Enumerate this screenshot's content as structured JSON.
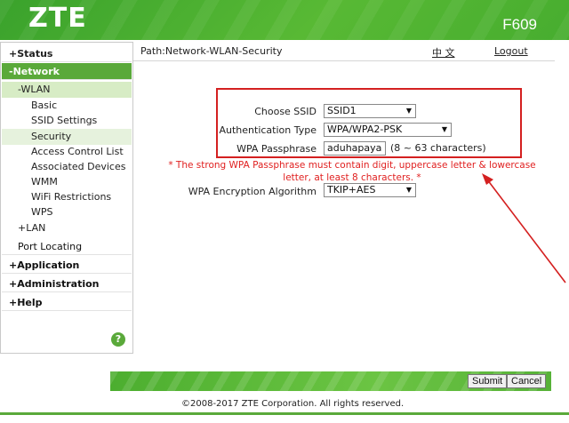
{
  "header": {
    "logo": "ZTE",
    "model": "F609"
  },
  "sidebar": {
    "status": "+Status",
    "network": "-Network",
    "wlan": "-WLAN",
    "wlan_items": [
      "Basic",
      "SSID Settings",
      "Security",
      "Access Control List",
      "Associated Devices",
      "WMM",
      "WiFi Restrictions",
      "WPS"
    ],
    "lan": "+LAN",
    "port_locating": "Port Locating",
    "application": "+Application",
    "administration": "+Administration",
    "help": "+Help",
    "help_icon": "?"
  },
  "pathbar": {
    "path": "Path:Network-WLAN-Security",
    "lang": "中 文",
    "logout": "Logout"
  },
  "form": {
    "ssid_label": "Choose SSID",
    "ssid_value": "SSID1",
    "auth_label": "Authentication Type",
    "auth_value": "WPA/WPA2-PSK",
    "pass_label": "WPA Passphrase",
    "pass_value": "aduhapaya",
    "pass_hint": "(8 ~ 63 characters)",
    "warning": "* The strong WPA Passphrase must contain digit, uppercase letter & lowercase letter, at least 8 characters. *",
    "enc_label": "WPA Encryption Algorithm",
    "enc_value": "TKIP+AES"
  },
  "footer": {
    "submit": "Submit",
    "cancel": "Cancel",
    "copyright": "©2008-2017 ZTE Corporation. All rights reserved."
  },
  "colors": {
    "brand_green": "#5aa93a",
    "annotation_red": "#d42020"
  }
}
